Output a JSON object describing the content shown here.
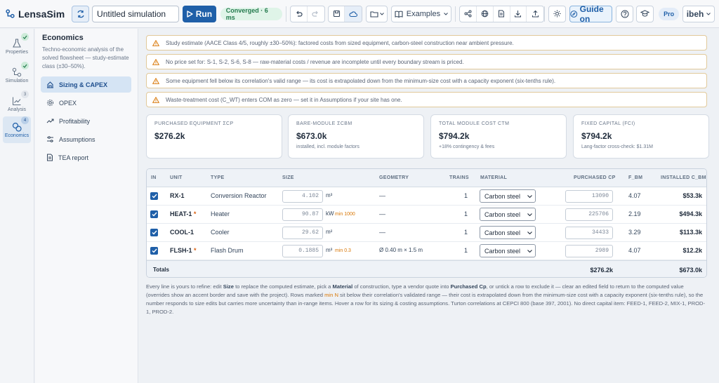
{
  "app": {
    "name": "LensaSim"
  },
  "topbar": {
    "project_name": "Untitled simulation",
    "run_label": "Run",
    "status": "Converged · 6 ms",
    "examples_label": "Examples",
    "guide_label": "Guide on",
    "plan_badge": "Pro",
    "user": "ibeh"
  },
  "rail": [
    {
      "label": "Properties",
      "icon": "flask-icon",
      "badge": "check"
    },
    {
      "label": "Simulation",
      "icon": "network-icon",
      "badge": "check"
    },
    {
      "label": "Analysis",
      "icon": "chart-line-icon",
      "badge": "3"
    },
    {
      "label": "Economics",
      "icon": "coins-icon",
      "badge": "4"
    }
  ],
  "subnav": {
    "title": "Economics",
    "description": "Techno-economic analysis of the solved flowsheet — study-estimate class (±30–50%).",
    "items": [
      {
        "label": "Sizing & CAPEX",
        "icon": "calculator-icon"
      },
      {
        "label": "OPEX",
        "icon": "gear-icon"
      },
      {
        "label": "Profitability",
        "icon": "trend-icon"
      },
      {
        "label": "Assumptions",
        "icon": "sliders-icon"
      },
      {
        "label": "TEA report",
        "icon": "document-icon"
      }
    ]
  },
  "warnings": [
    "Study estimate (AACE Class 4/5, roughly ±30–50%): factored costs from sized equipment, carbon-steel construction near ambient pressure.",
    "No price set for: S-1, S-2, S-6, S-8 — raw-material costs / revenue are incomplete until every boundary stream is priced.",
    "Some equipment fell below its correlation's valid range — its cost is extrapolated down from the minimum-size cost with a capacity exponent (six-tenths rule).",
    "Waste-treatment cost (C_WT) enters COM as zero — set it in Assumptions if your site has one."
  ],
  "cards": [
    {
      "label": "PURCHASED EQUIPMENT ΣCP",
      "value": "$276.2k",
      "sub": ""
    },
    {
      "label": "BARE-MODULE ΣCBM",
      "value": "$673.0k",
      "sub": "installed, incl. module factors"
    },
    {
      "label": "TOTAL MODULE COST CTM",
      "value": "$794.2k",
      "sub": "+18% contingency & fees"
    },
    {
      "label": "FIXED CAPITAL (FCI)",
      "value": "$794.2k",
      "sub": "Lang-factor cross-check: $1.31M"
    }
  ],
  "table": {
    "headers": [
      "IN",
      "UNIT",
      "TYPE",
      "SIZE",
      "GEOMETRY",
      "TRAINS",
      "MATERIAL",
      "PURCHASED CP",
      "F_BM",
      "INSTALLED C_BM"
    ],
    "rows": [
      {
        "included": true,
        "unit": "RX-1",
        "flag": "",
        "type": "Conversion Reactor",
        "size": "4.102",
        "size_unit": "m³",
        "min": "",
        "geometry": "—",
        "trains": "1",
        "material": "Carbon steel",
        "cp": "13090",
        "fbm": "4.07",
        "cbm": "$53.3k"
      },
      {
        "included": true,
        "unit": "HEAT-1",
        "flag": "*",
        "type": "Heater",
        "size": "90.87",
        "size_unit": "kW",
        "min": "min 1000",
        "geometry": "—",
        "trains": "1",
        "material": "Carbon steel",
        "cp": "225706",
        "fbm": "2.19",
        "cbm": "$494.3k"
      },
      {
        "included": true,
        "unit": "COOL-1",
        "flag": "",
        "type": "Cooler",
        "size": "29.62",
        "size_unit": "m²",
        "min": "",
        "geometry": "—",
        "trains": "1",
        "material": "Carbon steel",
        "cp": "34433",
        "fbm": "3.29",
        "cbm": "$113.3k"
      },
      {
        "included": true,
        "unit": "FLSH-1",
        "flag": "*",
        "type": "Flash Drum",
        "size": "0.1885",
        "size_unit": "m³",
        "min": "min 0.3",
        "geometry": "Ø 0.40 m × 1.5 m",
        "trains": "1",
        "material": "Carbon steel",
        "cp": "2989",
        "fbm": "4.07",
        "cbm": "$12.2k"
      }
    ],
    "totals": {
      "label": "Totals",
      "cp": "$276.2k",
      "cbm": "$673.0k"
    }
  },
  "footnote": {
    "p1": "Every line is yours to refine: edit ",
    "k1": "Size",
    "p2": " to replace the computed estimate, pick a ",
    "k2": "Material",
    "p3": " of construction, type a vendor quote into ",
    "k3": "Purchased Cp",
    "p4": ", or untick a row to exclude it — clear an edited field to return to the computed value (overrides show an accent border and save with the project). Rows marked ",
    "k4": "min N",
    "p5": " sit below their correlation's validated range — their cost is extrapolated down from the minimum-size cost with a capacity exponent (six-tenths rule), so the number responds to size edits but carries more uncertainty than in-range items. Hover a row for its sizing & costing assumptions. Turton correlations at CEPCI 800 (base 397, 2001). No direct capital item: FEED-1, FEED-2, MIX-1, PROD-1, PROD-2."
  },
  "colors": {
    "accent": "#1f5fa8",
    "warning": "#d97706",
    "success": "#237a4d"
  }
}
